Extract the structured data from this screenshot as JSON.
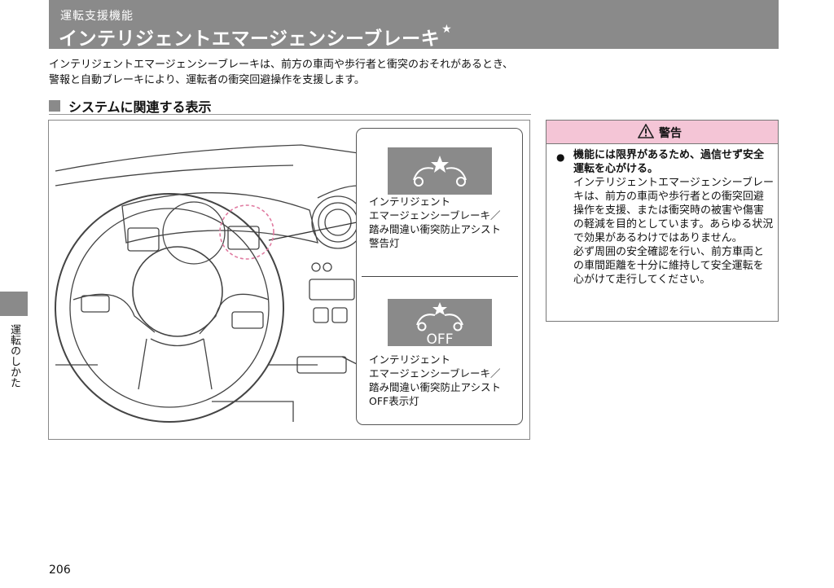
{
  "header": {
    "subtitle": "運転支援機能",
    "title": "インテリジェントエマージェンシーブレーキ",
    "title_mark": "★"
  },
  "intro": {
    "line1": "インテリジェントエマージェンシーブレーキは、前方の車両や歩行者と衝突のおそれがあるとき、",
    "line2": "警報と自動ブレーキにより、運転者の衝突回避操作を支援します。"
  },
  "section": {
    "title": "システムに関連する表示"
  },
  "indicators": [
    {
      "label": "インテリジェント\nエマージェンシーブレーキ／\n踏み間違い衝突防止アシスト\n警告灯",
      "icon": "collision-warning-icon"
    },
    {
      "label": "インテリジェント\nエマージェンシーブレーキ／\n踏み間違い衝突防止アシスト\nOFF表示灯",
      "icon": "collision-off-icon",
      "icon_text": "OFF"
    }
  ],
  "warning": {
    "title": "警告",
    "bullet": "●",
    "bold_text": "機能には限界があるため、過信せず安全運転を心がける。",
    "para1": "インテリジェントエマージェンシーブレーキは、前方の車両や歩行者との衝突回避操作を支援、または衝突時の被害や傷害の軽減を目的としています。あらゆる状況で効果があるわけではありません。",
    "para2": "必ず周囲の安全確認を行い、前方車両との車間距離を十分に維持して安全運転を心がけて走行してください。",
    "header_color": "#f4c5d6"
  },
  "side_tab": {
    "text": "運転のしかた"
  },
  "page_number": "206",
  "colors": {
    "header_bg": "#8a8a8a",
    "highlight_circle": "#e07aa0"
  }
}
